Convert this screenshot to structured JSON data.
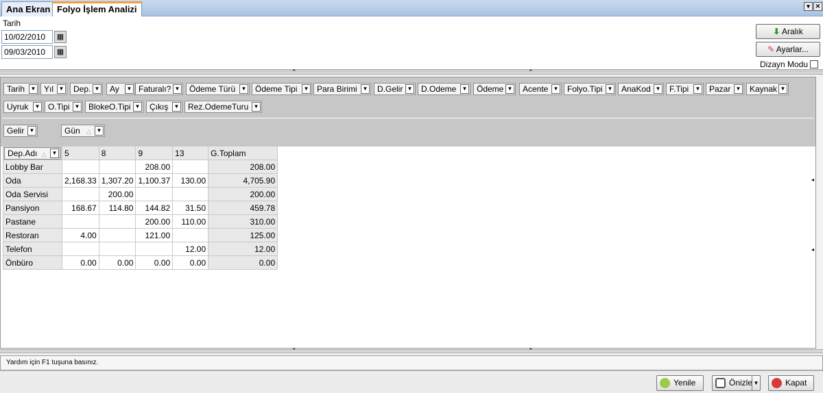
{
  "tabs": [
    {
      "label": "Ana Ekran"
    },
    {
      "label": "Folyo İşlem Analizi"
    }
  ],
  "filter": {
    "date_label": "Tarih",
    "date_from": "10/02/2010",
    "date_to": "09/03/2010"
  },
  "actions": {
    "range_label": "Aralık",
    "settings_label": "Ayarlar...",
    "design_mode_label": "Dizayn Modu"
  },
  "fields": {
    "filter_fields": [
      "Tarih",
      "Yıl",
      "Dep.",
      "Ay",
      "Faturalı?",
      "Ödeme Türü",
      "Ödeme Tipi",
      "Para Birimi",
      "D.Gelir",
      "D.Odeme",
      "Ödeme",
      "Acente",
      "Folyo.Tipi",
      "AnaKod",
      "F.Tipi",
      "Pazar",
      "Kaynak",
      "Uyruk",
      "O.Tipi",
      "BlokeO.Tipi",
      "Çıkış",
      "Rez.OdemeTuru"
    ],
    "data_field": "Gelir",
    "column_field": "Gün",
    "row_field": "Dep.Adı"
  },
  "pivot": {
    "columns": [
      "5",
      "8",
      "9",
      "13"
    ],
    "total_label": "G.Toplam",
    "rows": [
      {
        "label": "Lobby Bar",
        "values": [
          "",
          "",
          "208.00",
          ""
        ],
        "total": "208.00"
      },
      {
        "label": "Oda",
        "values": [
          "2,168.33",
          "1,307.20",
          "1,100.37",
          "130.00"
        ],
        "total": "4,705.90"
      },
      {
        "label": "Oda Servisi",
        "values": [
          "",
          "200.00",
          "",
          ""
        ],
        "total": "200.00"
      },
      {
        "label": "Pansiyon",
        "values": [
          "168.67",
          "114.80",
          "144.82",
          "31.50"
        ],
        "total": "459.78"
      },
      {
        "label": "Pastane",
        "values": [
          "",
          "",
          "200.00",
          "110.00"
        ],
        "total": "310.00"
      },
      {
        "label": "Restoran",
        "values": [
          "4.00",
          "",
          "121.00",
          ""
        ],
        "total": "125.00"
      },
      {
        "label": "Telefon",
        "values": [
          "",
          "",
          "",
          "12.00"
        ],
        "total": "12.00"
      },
      {
        "label": "Önbüro",
        "values": [
          "0.00",
          "0.00",
          "0.00",
          "0.00"
        ],
        "total": "0.00"
      }
    ]
  },
  "status": {
    "help_text": "Yardım için F1 tuşuna basınız."
  },
  "footer": {
    "refresh_label": "Yenile",
    "preview_label": "Önizle",
    "close_label": "Kapat"
  }
}
